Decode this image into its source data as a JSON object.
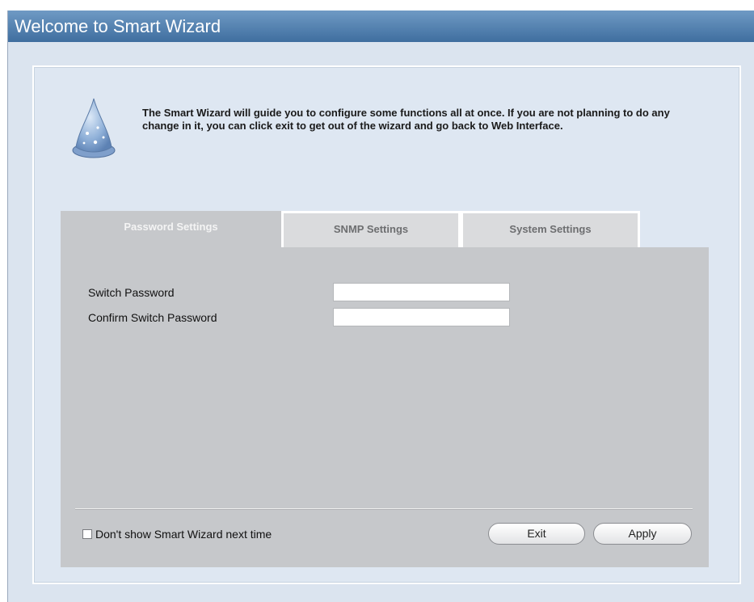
{
  "window": {
    "title": "Welcome to Smart Wizard"
  },
  "intro": {
    "text": "The Smart Wizard will guide you to configure some functions all at once. If you are not planning to do any change in it, you can click exit to get out of the wizard and go back to Web Interface."
  },
  "tabs": [
    {
      "label": "Password Settings",
      "active": true
    },
    {
      "label": "SNMP Settings",
      "active": false
    },
    {
      "label": "System Settings",
      "active": false
    }
  ],
  "password_form": {
    "fields": [
      {
        "label": "Switch Password",
        "value": ""
      },
      {
        "label": "Confirm Switch Password",
        "value": ""
      }
    ]
  },
  "footer": {
    "checkbox_label": "Don't show Smart Wizard next time",
    "checkbox_checked": false,
    "exit_label": "Exit",
    "apply_label": "Apply"
  },
  "icons": {
    "wizard": "wizard-hat-icon"
  },
  "colors": {
    "title_bar": "#4f7eae",
    "panel_background": "#dee7f2",
    "tab_content": "#c6c8cb"
  }
}
